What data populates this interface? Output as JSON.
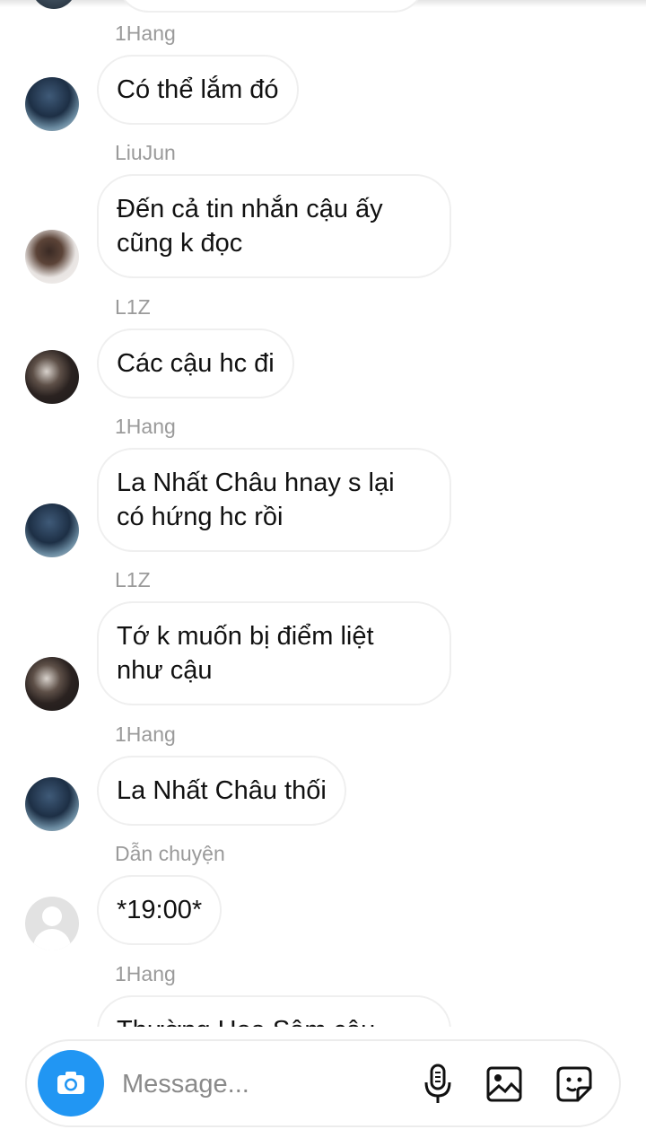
{
  "composer": {
    "placeholder": "Message...",
    "icons": [
      "camera-icon",
      "microphone-icon",
      "image-icon",
      "sticker-icon"
    ],
    "accent_color": "#2196f3"
  },
  "messages": [
    {
      "sender": "1Hang",
      "text": "Có thể lắm đó"
    },
    {
      "sender": "LiuJun",
      "text_lines": [
        "Đến cả tin nhắn cậu ấy",
        "cũng k đọc"
      ]
    },
    {
      "sender": "L1Z",
      "text": "Các cậu hc đi"
    },
    {
      "sender": "1Hang",
      "text_lines": [
        "La Nhất Châu hnay s lại",
        "có hứng hc rồi"
      ]
    },
    {
      "sender": "L1Z",
      "text_lines": [
        "Tớ k muốn bị điểm liệt",
        "như cậu"
      ]
    },
    {
      "sender": "1Hang",
      "text": "La Nhất Châu thối"
    },
    {
      "sender": "Dẫn chuyện",
      "text": "*19:00*"
    },
    {
      "sender": "1Hang",
      "text": "Thường Hoa Sâm cậu"
    }
  ]
}
